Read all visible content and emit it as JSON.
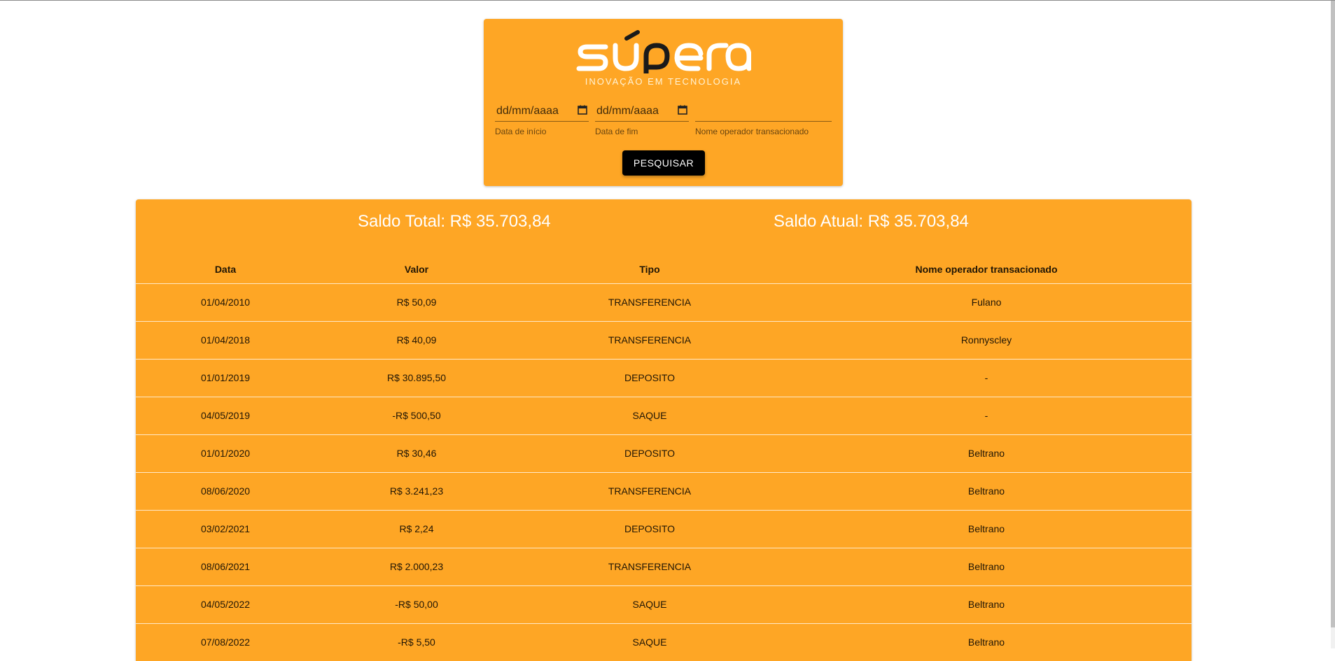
{
  "brand": {
    "name": "supera",
    "tagline": "INOVAÇÃO EM TECNOLOGIA",
    "color": "#fea625"
  },
  "filters": {
    "start_date": {
      "value": "dd/mm/aaaa",
      "label": "Data de início"
    },
    "end_date": {
      "value": "dd/mm/aaaa",
      "label": "Data de fim"
    },
    "operator_name": {
      "value": "",
      "label": "Nome operador transacionado"
    },
    "search_button": "PESQUISAR"
  },
  "balances": {
    "total": "Saldo Total: R$ 35.703,84",
    "current": "Saldo Atual: R$ 35.703,84"
  },
  "table": {
    "columns": [
      "Data",
      "Valor",
      "Tipo",
      "Nome operador transacionado"
    ],
    "rows": [
      [
        "01/04/2010",
        "R$ 50,09",
        "TRANSFERENCIA",
        "Fulano"
      ],
      [
        "01/04/2018",
        "R$ 40,09",
        "TRANSFERENCIA",
        "Ronnyscley"
      ],
      [
        "01/01/2019",
        "R$ 30.895,50",
        "DEPOSITO",
        "-"
      ],
      [
        "04/05/2019",
        "-R$ 500,50",
        "SAQUE",
        "-"
      ],
      [
        "01/01/2020",
        "R$ 30,46",
        "DEPOSITO",
        "Beltrano"
      ],
      [
        "08/06/2020",
        "R$ 3.241,23",
        "TRANSFERENCIA",
        "Beltrano"
      ],
      [
        "03/02/2021",
        "R$ 2,24",
        "DEPOSITO",
        "Beltrano"
      ],
      [
        "08/06/2021",
        "R$ 2.000,23",
        "TRANSFERENCIA",
        "Beltrano"
      ],
      [
        "04/05/2022",
        "-R$ 50,00",
        "SAQUE",
        "Beltrano"
      ],
      [
        "07/08/2022",
        "-R$ 5,50",
        "SAQUE",
        "Beltrano"
      ]
    ]
  }
}
